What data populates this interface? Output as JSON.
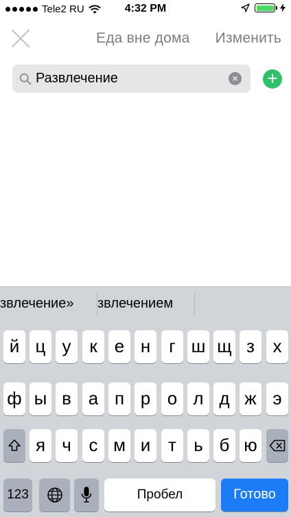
{
  "status_bar": {
    "carrier": "Tele2 RU",
    "time": "4:32 PM"
  },
  "navbar": {
    "title": "Еда вне дома",
    "edit_label": "Изменить"
  },
  "search": {
    "value": "Развлечение"
  },
  "keyboard": {
    "suggestions": [
      "звлечение»",
      "звлечением",
      ""
    ],
    "row1": [
      "й",
      "ц",
      "у",
      "к",
      "е",
      "н",
      "г",
      "ш",
      "щ",
      "з",
      "х"
    ],
    "row2": [
      "ф",
      "ы",
      "в",
      "а",
      "п",
      "р",
      "о",
      "л",
      "д",
      "ж",
      "э"
    ],
    "row3": [
      "я",
      "ч",
      "с",
      "м",
      "и",
      "т",
      "ь",
      "б",
      "ю"
    ],
    "numbers_label": "123",
    "space_label": "Пробел",
    "return_label": "Готово"
  },
  "colors": {
    "accent_green": "#2ec16a",
    "return_blue": "#1b7cf5",
    "battery_green": "#4cd964"
  },
  "icons": [
    "signal-dots-icon",
    "wifi-icon",
    "location-arrow-icon",
    "battery-icon",
    "charging-bolt-icon",
    "close-icon",
    "search-icon",
    "clear-icon",
    "add-icon",
    "shift-icon",
    "globe-icon",
    "microphone-icon",
    "backspace-icon"
  ]
}
